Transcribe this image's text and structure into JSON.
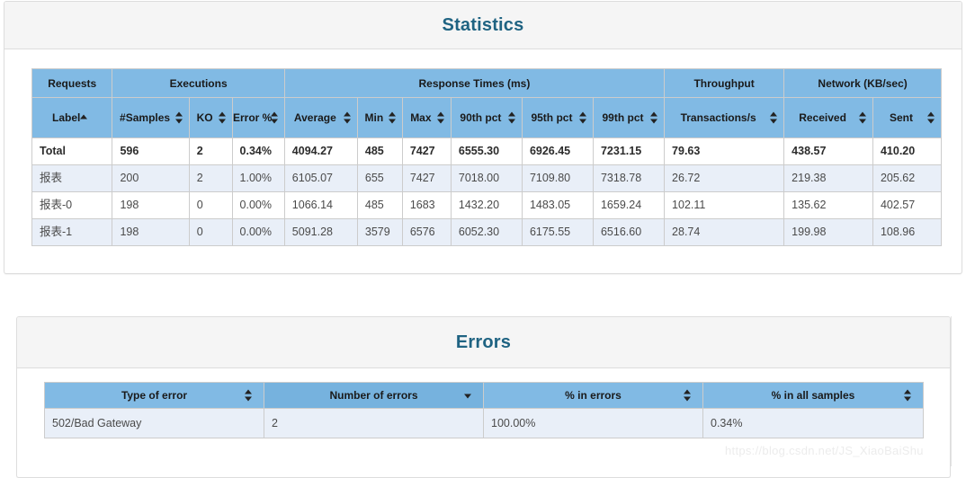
{
  "statistics": {
    "title": "Statistics",
    "group_headers": [
      {
        "label": "Requests",
        "span": 1
      },
      {
        "label": "Executions",
        "span": 3
      },
      {
        "label": "Response Times (ms)",
        "span": 6
      },
      {
        "label": "Throughput",
        "span": 1
      },
      {
        "label": "Network (KB/sec)",
        "span": 2
      }
    ],
    "columns": [
      {
        "label": "Label",
        "sort": "asc"
      },
      {
        "label": "#Samples",
        "sort": "both"
      },
      {
        "label": "KO",
        "sort": "both"
      },
      {
        "label": "Error %",
        "sort": "both"
      },
      {
        "label": "Average",
        "sort": "both"
      },
      {
        "label": "Min",
        "sort": "both"
      },
      {
        "label": "Max",
        "sort": "both"
      },
      {
        "label": "90th pct",
        "sort": "both"
      },
      {
        "label": "95th pct",
        "sort": "both"
      },
      {
        "label": "99th pct",
        "sort": "both"
      },
      {
        "label": "Transactions/s",
        "sort": "both"
      },
      {
        "label": "Received",
        "sort": "both"
      },
      {
        "label": "Sent",
        "sort": "both"
      }
    ],
    "rows": [
      {
        "type": "total",
        "cells": [
          "Total",
          "596",
          "2",
          "0.34%",
          "4094.27",
          "485",
          "7427",
          "6555.30",
          "6926.45",
          "7231.15",
          "79.63",
          "438.57",
          "410.20"
        ]
      },
      {
        "type": "odd",
        "cells": [
          "报表",
          "200",
          "2",
          "1.00%",
          "6105.07",
          "655",
          "7427",
          "7018.00",
          "7109.80",
          "7318.78",
          "26.72",
          "219.38",
          "205.62"
        ]
      },
      {
        "type": "even",
        "cells": [
          "报表-0",
          "198",
          "0",
          "0.00%",
          "1066.14",
          "485",
          "1683",
          "1432.20",
          "1483.05",
          "1659.24",
          "102.11",
          "135.62",
          "402.57"
        ]
      },
      {
        "type": "odd",
        "cells": [
          "报表-1",
          "198",
          "0",
          "0.00%",
          "5091.28",
          "3579",
          "6576",
          "6052.30",
          "6175.55",
          "6516.60",
          "28.74",
          "199.98",
          "108.96"
        ]
      }
    ]
  },
  "errors": {
    "title": "Errors",
    "columns": [
      {
        "label": "Type of error",
        "sort": "both",
        "active": false
      },
      {
        "label": "Number of errors",
        "sort": "desc",
        "active": true
      },
      {
        "label": "% in errors",
        "sort": "both",
        "active": false
      },
      {
        "label": "% in all samples",
        "sort": "both",
        "active": false
      }
    ],
    "rows": [
      {
        "cells": [
          "502/Bad Gateway",
          "2",
          "100.00%",
          "0.34%"
        ]
      }
    ]
  },
  "watermark": {
    "text": "https://blog.csdn.net/JS_XiaoBaiShu"
  },
  "colors": {
    "title": "#1f6382",
    "header_blue": "#81bae4",
    "header_blue_active": "#76b2de",
    "row_stripe": "#e9eff8",
    "panel_heading": "#f5f5f5"
  }
}
